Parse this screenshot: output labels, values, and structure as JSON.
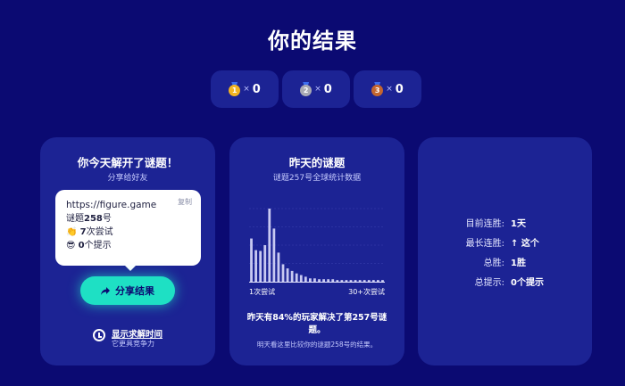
{
  "page": {
    "title": "你的结果"
  },
  "medals": [
    {
      "icon": "gold-medal-icon",
      "color": "#f2b322",
      "num": "1",
      "times": "×",
      "count": "0"
    },
    {
      "icon": "silver-medal-icon",
      "color": "#a9aab4",
      "num": "2",
      "times": "×",
      "count": "0"
    },
    {
      "icon": "bronze-medal-icon",
      "color": "#c4662f",
      "num": "3",
      "times": "×",
      "count": "0"
    }
  ],
  "share_card": {
    "title": "你今天解开了谜题！",
    "subtitle": "分享给好友",
    "copy_label": "复制",
    "url": "https://figure.game",
    "puzzle_prefix": "谜题",
    "puzzle_number": "258",
    "puzzle_suffix": "号",
    "attempts_emoji": "👏",
    "attempts_value": "7",
    "attempts_suffix": "次尝试",
    "hints_emoji": "😎",
    "hints_value": "0",
    "hints_suffix": "个提示",
    "share_button": "分享结果",
    "solve_time_link": "显示求解时间",
    "solve_time_sub": "它更具竞争力"
  },
  "yesterday_card": {
    "title": "昨天的谜题",
    "subtitle": "谜题257号全球统计数据",
    "axis_left": "1次尝试",
    "axis_right": "30+次尝试",
    "fact": "昨天有84%的玩家解决了第257号谜题。",
    "fact_sub": "明天看这里比较你的谜题258号的结果。"
  },
  "chart_data": {
    "type": "bar",
    "x_start_label": "1次尝试",
    "x_end_label": "30+次尝试",
    "values": [
      52,
      38,
      37,
      44,
      88,
      64,
      35,
      21,
      16,
      13,
      10,
      8,
      6,
      4,
      4,
      3,
      3,
      3,
      3,
      2,
      2,
      2,
      2,
      2,
      2,
      2,
      2,
      2,
      2,
      2
    ],
    "bar_color": "#c8c9f2",
    "grid": true
  },
  "stats_card": {
    "rows": [
      {
        "label": "目前连胜:",
        "value": "1天"
      },
      {
        "label": "最长连胜:",
        "value": "↑ 这个"
      },
      {
        "label": "总胜:",
        "value": "1胜"
      },
      {
        "label": "总提示:",
        "value": "0个提示"
      }
    ]
  }
}
